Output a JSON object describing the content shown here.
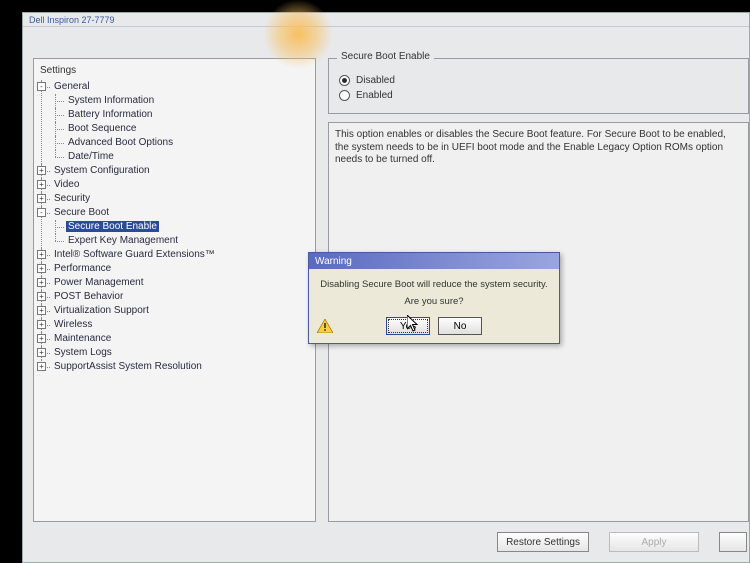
{
  "window": {
    "title": "Dell Inspiron 27-7779"
  },
  "tree": {
    "root": "Settings",
    "nodes": [
      {
        "label": "General",
        "expanded": true,
        "children": [
          {
            "label": "System Information"
          },
          {
            "label": "Battery Information"
          },
          {
            "label": "Boot Sequence"
          },
          {
            "label": "Advanced Boot Options"
          },
          {
            "label": "Date/Time"
          }
        ]
      },
      {
        "label": "System Configuration",
        "expanded": false
      },
      {
        "label": "Video",
        "expanded": false
      },
      {
        "label": "Security",
        "expanded": false
      },
      {
        "label": "Secure Boot",
        "expanded": true,
        "children": [
          {
            "label": "Secure Boot Enable",
            "selected": true
          },
          {
            "label": "Expert Key Management"
          }
        ]
      },
      {
        "label": "Intel® Software Guard Extensions™",
        "expanded": false
      },
      {
        "label": "Performance",
        "expanded": false
      },
      {
        "label": "Power Management",
        "expanded": false
      },
      {
        "label": "POST Behavior",
        "expanded": false
      },
      {
        "label": "Virtualization Support",
        "expanded": false
      },
      {
        "label": "Wireless",
        "expanded": false
      },
      {
        "label": "Maintenance",
        "expanded": false
      },
      {
        "label": "System Logs",
        "expanded": false
      },
      {
        "label": "SupportAssist System Resolution",
        "expanded": false
      }
    ]
  },
  "panel": {
    "title": "Secure Boot Enable",
    "options": [
      {
        "name": "disabled",
        "label": "Disabled",
        "checked": true
      },
      {
        "name": "enabled",
        "label": "Enabled",
        "checked": false
      }
    ],
    "description": "This option enables or disables the Secure Boot feature. For Secure Boot to be enabled, the system needs to be in UEFI boot mode and the Enable Legacy Option ROMs option needs to be turned off."
  },
  "buttons": {
    "restore": "Restore Settings",
    "apply": "Apply"
  },
  "dialog": {
    "title": "Warning",
    "message": "Disabling Secure Boot will reduce the system security.",
    "prompt": "Are you sure?",
    "yes": "Yes",
    "no": "No"
  }
}
